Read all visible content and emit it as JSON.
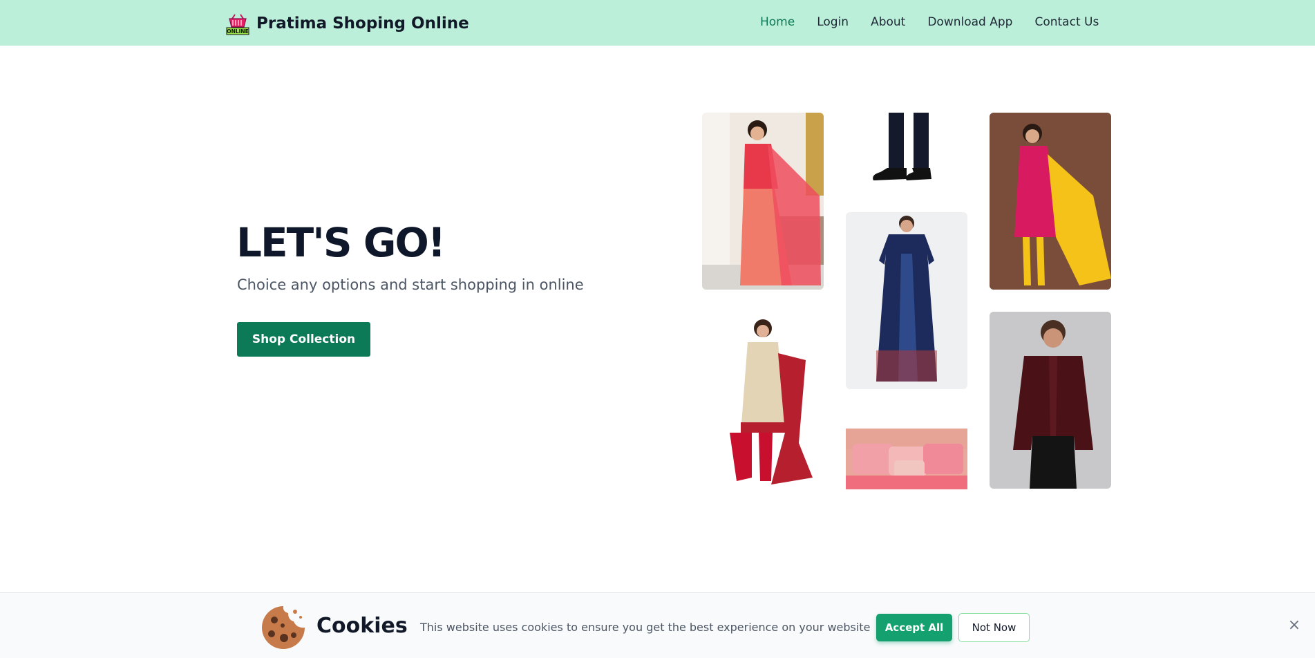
{
  "navbar": {
    "brand_name": "Pratima Shoping Online",
    "logo_badge_text": "ONLINE",
    "links": [
      {
        "label": "Home",
        "active": true
      },
      {
        "label": "Login",
        "active": false
      },
      {
        "label": "About",
        "active": false
      },
      {
        "label": "Download App",
        "active": false
      },
      {
        "label": "Contact Us",
        "active": false
      }
    ]
  },
  "hero": {
    "title": "LET'S GO!",
    "subtitle": "Choice any options and start shopping in online",
    "button_label": "Shop Collection"
  },
  "gallery": {
    "images": [
      {
        "name": "red-saree-image"
      },
      {
        "name": "mens-shoes-image"
      },
      {
        "name": "pink-salwar-suit-image"
      },
      {
        "name": "blue-nightgown-image"
      },
      {
        "name": "beige-red-salwar-suit-image"
      },
      {
        "name": "maroon-shirt-image"
      },
      {
        "name": "pink-cushions-image"
      }
    ]
  },
  "cookies": {
    "title": "Cookies",
    "message": "This website uses cookies to ensure you get the best experience on your website",
    "accept_label": "Accept All",
    "decline_label": "Not Now",
    "close_icon": "×"
  },
  "colors": {
    "navbar_bg": "#bcefd9",
    "primary": "#0d7a57",
    "accept": "#14a06f"
  }
}
